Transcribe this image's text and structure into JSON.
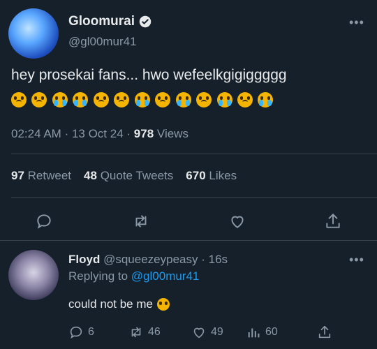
{
  "tweet": {
    "display_name": "Gloomurai",
    "handle": "@gl00mur41",
    "text": "hey prosekai fans... hwo wefeelkgigiggggg",
    "emoji_row": [
      "pleading",
      "pleading",
      "sob",
      "sob",
      "pleading",
      "frowning",
      "sob",
      "slight-frown",
      "sob",
      "slight-frown",
      "sob",
      "slight-frown",
      "sob"
    ],
    "time": "02:24 AM",
    "date": "13 Oct 24",
    "views_count": "978",
    "views_label": "Views",
    "retweets_count": "97",
    "retweets_label": "Retweet",
    "quotes_count": "48",
    "quotes_label": "Quote Tweets",
    "likes_count": "670",
    "likes_label": "Likes"
  },
  "reply": {
    "display_name": "Floyd",
    "handle": "@squeezeypeasy",
    "time_ago": "16s",
    "replying_prefix": "Replying to",
    "replying_handle": "@gl00mur41",
    "text": "could not be me",
    "replies": "6",
    "retweets": "46",
    "likes": "49",
    "views": "60"
  },
  "colors": {
    "background": "#15202b",
    "accent": "#1d9bf0",
    "muted": "#8b98a5"
  }
}
